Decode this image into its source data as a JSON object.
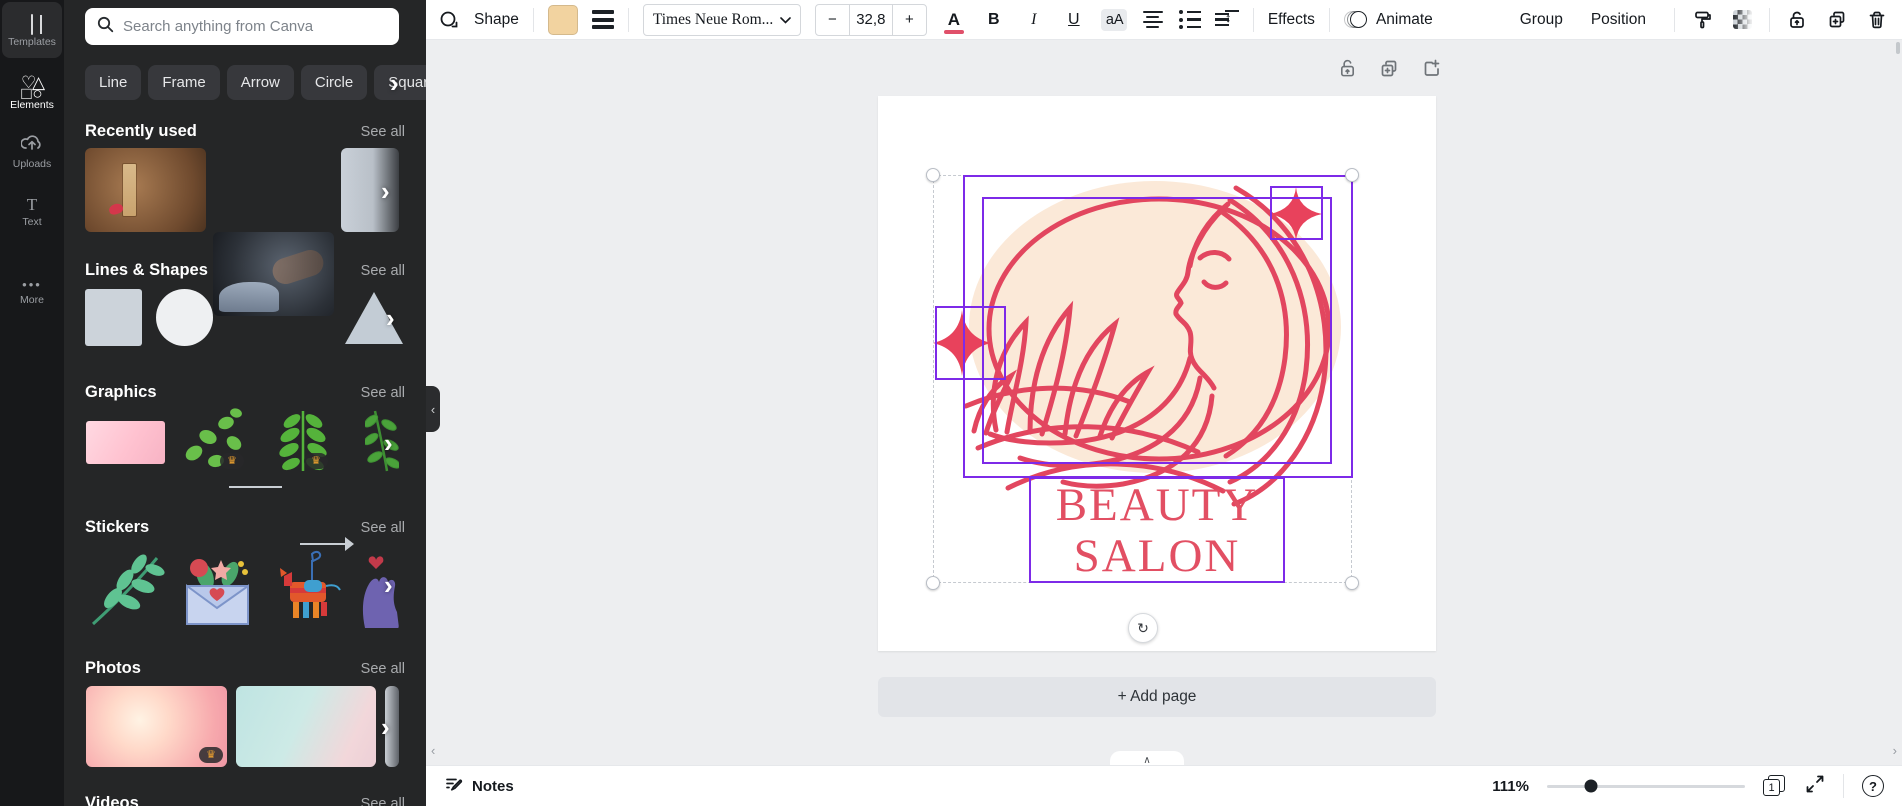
{
  "sidebar": {
    "items": [
      {
        "label": "Templates"
      },
      {
        "label": "Elements"
      },
      {
        "label": "Uploads"
      },
      {
        "label": "Text"
      },
      {
        "label": "More"
      }
    ]
  },
  "panel": {
    "search": {
      "placeholder": "Search anything from Canva"
    },
    "chips": [
      "Line",
      "Frame",
      "Arrow",
      "Circle",
      "Square"
    ],
    "see_all_label": "See all",
    "sections": [
      {
        "title": "Recently used"
      },
      {
        "title": "Lines & Shapes"
      },
      {
        "title": "Graphics"
      },
      {
        "title": "Stickers"
      },
      {
        "title": "Photos"
      },
      {
        "title": "Videos"
      }
    ]
  },
  "toolbar": {
    "shape_label": "Shape",
    "font_name": "Times Neue Rom...",
    "minus_label": "−",
    "font_size": "32,8",
    "plus_label": "+",
    "text_color_letter": "A",
    "bold_label": "B",
    "italic_label": "I",
    "underline_label": "U",
    "case_label": "aA",
    "effects_label": "Effects",
    "animate_label": "Animate",
    "group_label": "Group",
    "position_label": "Position"
  },
  "canvas": {
    "design_text_line1": "BEAUTY",
    "design_text_line2": "SALON",
    "add_page_label": "+ Add page"
  },
  "statusbar": {
    "notes_label": "Notes",
    "zoom_percent": "111%",
    "page_number": "1"
  },
  "colors": {
    "selection_purple": "#7d2ae8",
    "logo_pink": "#e2465f",
    "logo_cream": "#fbe9d8",
    "swatch_peach": "#f2d3a0",
    "text_color_underline": "#e0506a"
  }
}
